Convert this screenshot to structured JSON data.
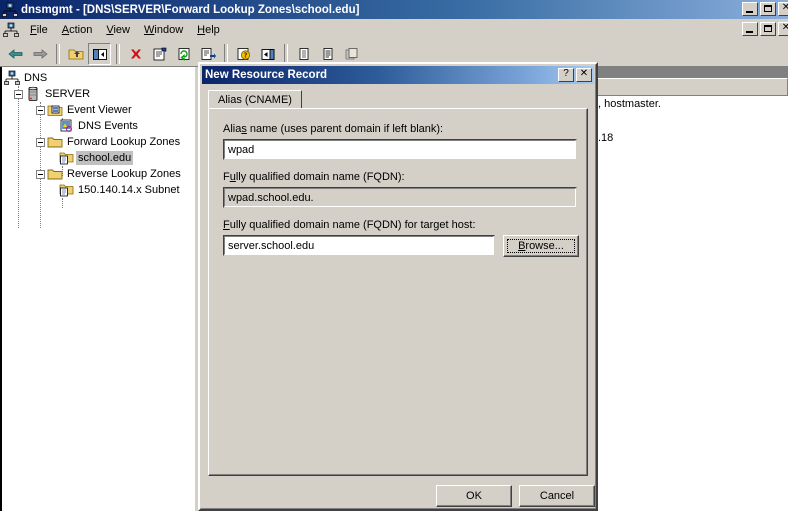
{
  "main_window": {
    "title": "dnsmgmt - [DNS\\SERVER\\Forward Lookup Zones\\school.edu]",
    "icon": "dns-server-icon",
    "controls": {
      "minimize": "_",
      "maximize": "□",
      "close": "×"
    }
  },
  "menubar": {
    "icon": "mmc-console-icon",
    "items": [
      {
        "label": "File",
        "accel": "F"
      },
      {
        "label": "Action",
        "accel": "A"
      },
      {
        "label": "View",
        "accel": "V"
      },
      {
        "label": "Window",
        "accel": "W"
      },
      {
        "label": "Help",
        "accel": "H"
      }
    ]
  },
  "toolbar": {
    "buttons": [
      {
        "name": "back-icon",
        "glyph": "←"
      },
      {
        "name": "forward-icon",
        "glyph": "→"
      },
      {
        "name": "up-one-level-icon",
        "glyph": "folder-up"
      },
      {
        "name": "show-hide-tree-icon",
        "glyph": "tree-pane"
      },
      {
        "name": "delete-icon",
        "glyph": "×"
      },
      {
        "name": "properties-icon",
        "glyph": "properties"
      },
      {
        "name": "refresh-icon",
        "glyph": "refresh"
      },
      {
        "name": "export-list-icon",
        "glyph": "export"
      },
      {
        "name": "help-icon",
        "glyph": "help"
      },
      {
        "name": "show-window-icon",
        "glyph": "window"
      },
      {
        "name": "large-icons-icon",
        "glyph": "large"
      },
      {
        "name": "list-view-icon",
        "glyph": "list"
      },
      {
        "name": "detail-view-icon",
        "glyph": "detail"
      }
    ]
  },
  "tree": {
    "nodes": [
      {
        "label": "DNS",
        "depth": 0,
        "icon": "dns-root-icon",
        "expander": "none",
        "selected": false
      },
      {
        "label": "SERVER",
        "depth": 1,
        "icon": "server-icon",
        "expander": "minus",
        "selected": false
      },
      {
        "label": "Event Viewer",
        "depth": 2,
        "icon": "event-viewer-icon",
        "expander": "minus",
        "selected": false
      },
      {
        "label": "DNS Events",
        "depth": 3,
        "icon": "dns-events-icon",
        "expander": "none",
        "selected": false
      },
      {
        "label": "Forward Lookup Zones",
        "depth": 2,
        "icon": "folder-icon",
        "expander": "minus",
        "selected": false
      },
      {
        "label": "school.edu",
        "depth": 3,
        "icon": "zone-icon",
        "expander": "none",
        "selected": true
      },
      {
        "label": "Reverse Lookup Zones",
        "depth": 2,
        "icon": "folder-icon",
        "expander": "minus",
        "selected": false
      },
      {
        "label": "150.140.14.x Subnet",
        "depth": 3,
        "icon": "zone-icon",
        "expander": "none",
        "selected": false
      }
    ]
  },
  "list_pane": {
    "columns": [
      {
        "label": ""
      },
      {
        "label": ""
      }
    ],
    "rows": [
      {
        "text": ", hostmaster."
      },
      {
        "text": ""
      },
      {
        "text": ".18"
      }
    ]
  },
  "dialog": {
    "title": "New Resource Record",
    "controls": {
      "help": "?",
      "close": "×"
    },
    "tabs": [
      {
        "label": "Alias (CNAME)",
        "active": true
      }
    ],
    "fields": {
      "alias_name": {
        "label_pre": "Alia",
        "label_accel": "s",
        "label_post": " name (uses parent domain if left blank):",
        "value": "wpad",
        "placeholder": ""
      },
      "fqdn": {
        "label_pre": "F",
        "label_accel": "u",
        "label_post": "lly qualified domain name (FQDN):",
        "value": "wpad.school.edu.",
        "readonly": true
      },
      "target_fqdn": {
        "label_pre": "",
        "label_accel": "F",
        "label_post": "ully qualified domain name (FQDN) for target host:",
        "value": "server.school.edu",
        "placeholder": ""
      }
    },
    "buttons": {
      "browse": {
        "label_pre": "",
        "label_accel": "B",
        "label_post": "rowse...",
        "focused": true
      },
      "ok": {
        "label": "OK"
      },
      "cancel": {
        "label": "Cancel"
      }
    }
  },
  "colors": {
    "face": "#D4D0C8",
    "title_active_left": "#0A246A",
    "title_active_right": "#A6CAF0",
    "selection_inactive": "#C0C0C0",
    "window_bg": "#FFFFFF",
    "shadow": "#808080",
    "dark_shadow": "#404040",
    "highlight": "#FFFFFF",
    "header_strip": "#808080"
  }
}
